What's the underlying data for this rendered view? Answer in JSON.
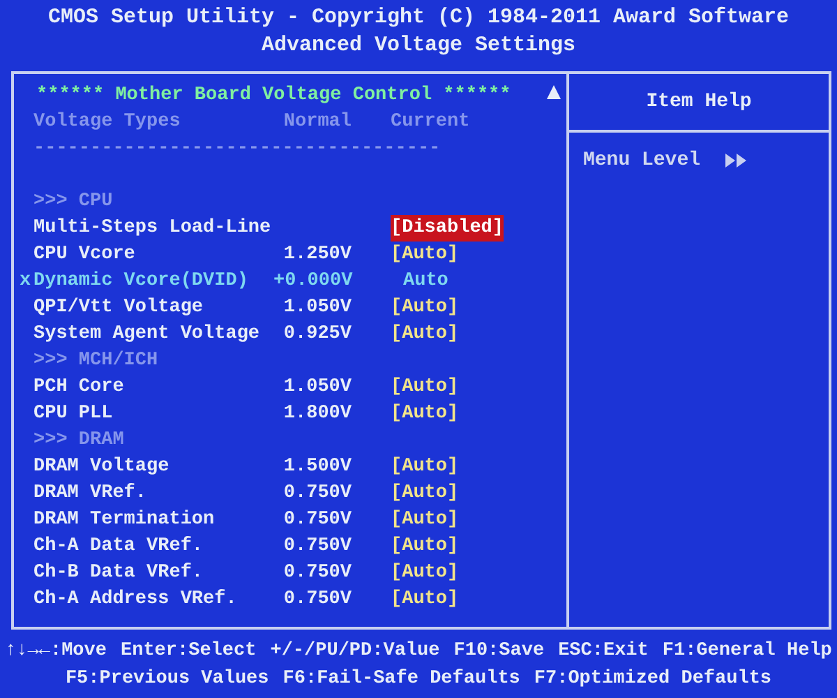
{
  "title_lines": [
    "CMOS Setup Utility - Copyright (C) 1984-2011 Award Software",
    "Advanced Voltage Settings"
  ],
  "panel": {
    "heading": "****** Mother Board Voltage Control ******",
    "columns": [
      "Voltage Types",
      "Normal",
      "Current"
    ],
    "rows": [
      {
        "kind": "rule",
        "name": "------------------------------------"
      },
      {
        "kind": "blank"
      },
      {
        "kind": "section",
        "name": ">>> CPU"
      },
      {
        "kind": "setting",
        "name": "Multi-Steps Load-Line",
        "value": "[Disabled]",
        "selected": true
      },
      {
        "kind": "setting",
        "name": "CPU Vcore",
        "normal": "1.250V",
        "value": "[Auto]",
        "selected": false
      },
      {
        "kind": "locked",
        "marker": "x",
        "name": "Dynamic Vcore(DVID)",
        "normal": "+0.000V",
        "value": "Auto"
      },
      {
        "kind": "setting",
        "name": "QPI/Vtt Voltage",
        "normal": "1.050V",
        "value": "[Auto]",
        "selected": false
      },
      {
        "kind": "setting",
        "name": "System Agent Voltage",
        "normal": "0.925V",
        "value": "[Auto]",
        "selected": false
      },
      {
        "kind": "section",
        "name": ">>> MCH/ICH"
      },
      {
        "kind": "setting",
        "name": "PCH Core",
        "normal": "1.050V",
        "value": "[Auto]",
        "selected": false
      },
      {
        "kind": "setting",
        "name": "CPU PLL",
        "normal": "1.800V",
        "value": "[Auto]",
        "selected": false
      },
      {
        "kind": "section",
        "name": ">>> DRAM"
      },
      {
        "kind": "setting",
        "name": "DRAM Voltage",
        "normal": "1.500V",
        "value": "[Auto]",
        "selected": false
      },
      {
        "kind": "setting",
        "name": "DRAM VRef.",
        "normal": "0.750V",
        "value": "[Auto]",
        "selected": false
      },
      {
        "kind": "setting",
        "name": "DRAM Termination",
        "normal": "0.750V",
        "value": "[Auto]",
        "selected": false
      },
      {
        "kind": "setting",
        "name": "Ch-A Data VRef.",
        "normal": "0.750V",
        "value": "[Auto]",
        "selected": false
      },
      {
        "kind": "setting",
        "name": "Ch-B Data VRef.",
        "normal": "0.750V",
        "value": "[Auto]",
        "selected": false
      },
      {
        "kind": "setting",
        "name": "Ch-A Address VRef.",
        "normal": "0.750V",
        "value": "[Auto]",
        "selected": false
      }
    ]
  },
  "help": {
    "title": "Item Help",
    "menu_level": "Menu Level"
  },
  "footer": [
    [
      "↑↓→←:Move",
      "Enter:Select",
      "+/-/PU/PD:Value",
      "F10:Save",
      "ESC:Exit",
      "F1:General Help"
    ],
    [
      "F5:Previous Values",
      "F6:Fail-Safe Defaults",
      "F7:Optimized Defaults"
    ]
  ]
}
